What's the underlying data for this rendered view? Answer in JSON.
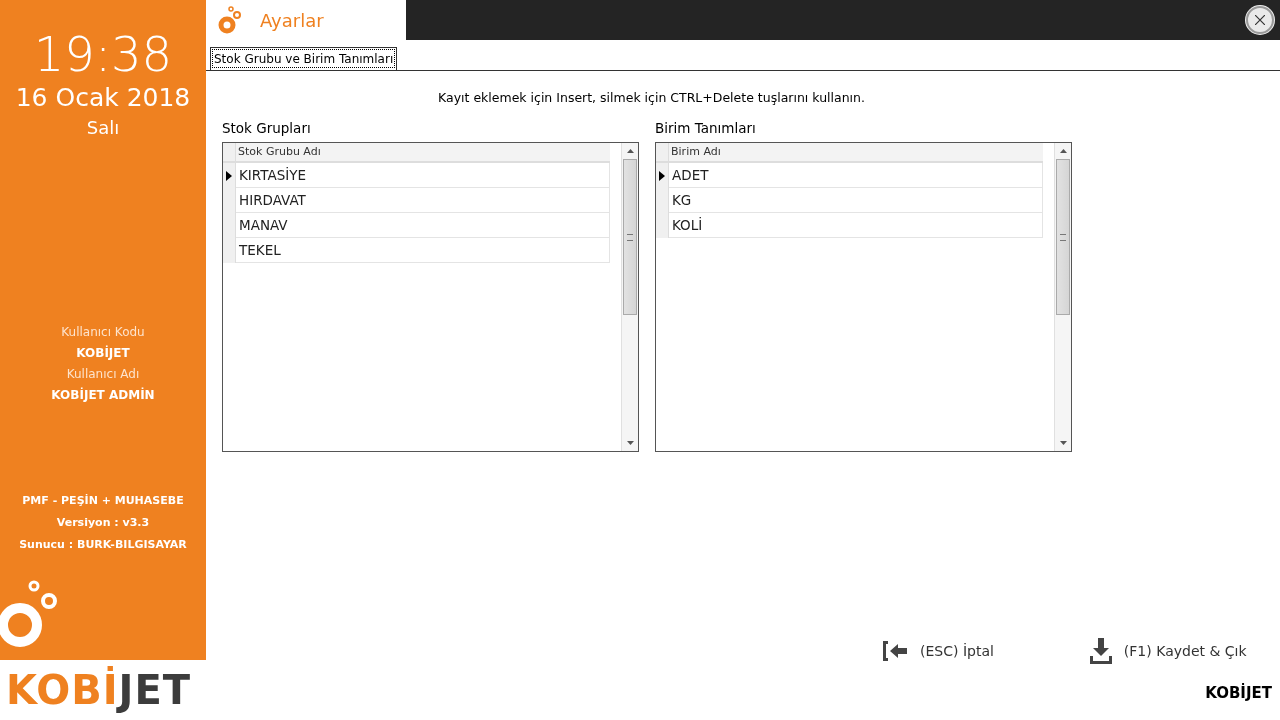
{
  "sidebar": {
    "time": "19:38",
    "date": "16 Ocak 2018",
    "day": "Salı",
    "user": [
      {
        "kind": "label",
        "text": "Kullanıcı Kodu"
      },
      {
        "kind": "value",
        "text": "KOBİJET"
      },
      {
        "kind": "label",
        "text": "Kullanıcı Adı"
      },
      {
        "kind": "value",
        "text": "KOBİJET ADMİN"
      }
    ],
    "info": [
      "PMF - PEŞİN + MUHASEBE",
      "Versiyon : v3.3",
      "Sunucu : BURK-BILGISAYAR"
    ],
    "logo": [
      {
        "text": "KOBİ",
        "color": "#ef8120"
      },
      {
        "text": "JET",
        "color": "#3c3c3c"
      }
    ]
  },
  "window": {
    "title": "Ayarlar"
  },
  "tabs": [
    {
      "label": "Stok Grubu ve Birim Tanımları",
      "selected": true
    }
  ],
  "hint": "Kayıt eklemek için Insert, silmek için CTRL+Delete  tuşlarını kullanın.",
  "grids": [
    {
      "title": "Stok Grupları",
      "column": "Stok Grubu Adı",
      "rows": [
        {
          "text": "KIRTASİYE",
          "selected": true
        },
        {
          "text": "HIRDAVAT",
          "selected": false
        },
        {
          "text": "MANAV",
          "selected": false
        },
        {
          "text": "TEKEL",
          "selected": false
        }
      ]
    },
    {
      "title": "Birim Tanımları",
      "column": "Birim Adı",
      "rows": [
        {
          "text": "ADET",
          "selected": true
        },
        {
          "text": "KG",
          "selected": false
        },
        {
          "text": "KOLİ",
          "selected": false
        }
      ]
    }
  ],
  "buttons": [
    {
      "kind": "cancel",
      "label": "(ESC) İptal"
    },
    {
      "kind": "save",
      "label": "(F1) Kaydet & Çık"
    }
  ],
  "footer": "KOBİJET"
}
